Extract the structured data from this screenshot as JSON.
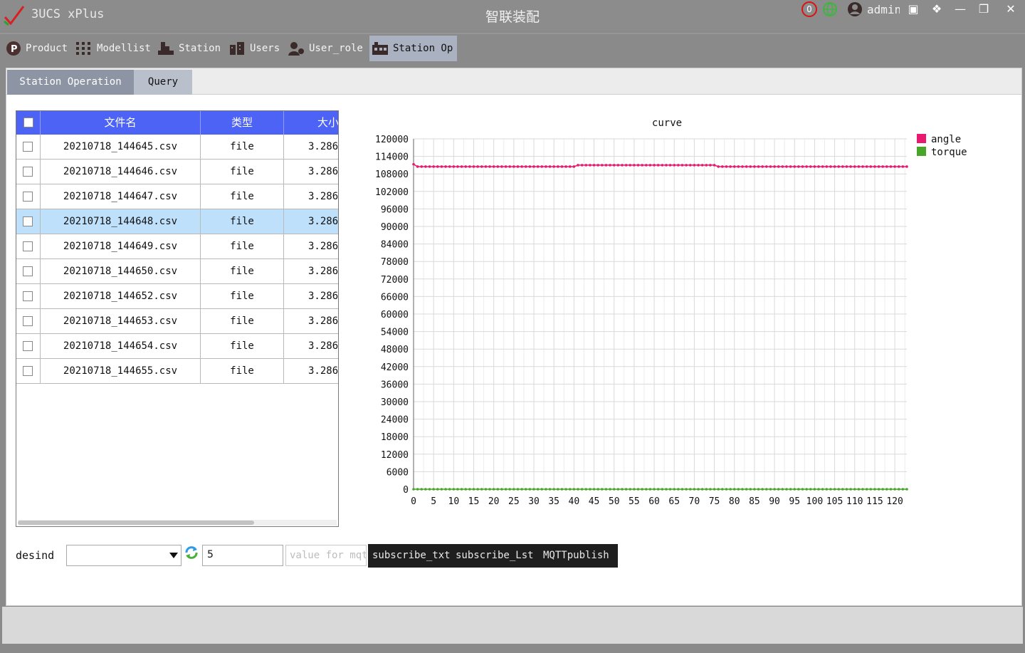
{
  "window": {
    "app_title": "3UCS xPlus",
    "center_title": "智联装配",
    "notification_count": "0",
    "user_name": "admin"
  },
  "nav": [
    {
      "label": "Product",
      "icon": "product-icon"
    },
    {
      "label": "Modellist",
      "icon": "modellist-icon"
    },
    {
      "label": "Station",
      "icon": "station-icon"
    },
    {
      "label": "Users",
      "icon": "users-icon"
    },
    {
      "label": "User_role",
      "icon": "user-role-icon"
    },
    {
      "label": "Station Op",
      "icon": "station-op-icon",
      "active": true
    }
  ],
  "tabs": [
    {
      "label": "Station Operation"
    },
    {
      "label": "Query"
    }
  ],
  "table": {
    "columns": [
      "文件名",
      "类型",
      "大小"
    ],
    "rows": [
      {
        "name": "20210718_144645.csv",
        "type": "file",
        "size": "3.286"
      },
      {
        "name": "20210718_144646.csv",
        "type": "file",
        "size": "3.286"
      },
      {
        "name": "20210718_144647.csv",
        "type": "file",
        "size": "3.286"
      },
      {
        "name": "20210718_144648.csv",
        "type": "file",
        "size": "3.286",
        "selected": true
      },
      {
        "name": "20210718_144649.csv",
        "type": "file",
        "size": "3.286"
      },
      {
        "name": "20210718_144650.csv",
        "type": "file",
        "size": "3.286"
      },
      {
        "name": "20210718_144652.csv",
        "type": "file",
        "size": "3.286"
      },
      {
        "name": "20210718_144653.csv",
        "type": "file",
        "size": "3.286"
      },
      {
        "name": "20210718_144654.csv",
        "type": "file",
        "size": "3.286"
      },
      {
        "name": "20210718_144655.csv",
        "type": "file",
        "size": "3.286"
      }
    ]
  },
  "controls": {
    "desind_label": "desind",
    "combo_value": "",
    "number_value": "5",
    "mqtt_placeholder": "value for mqtt",
    "buttons": [
      "subscribe_txt",
      "subscribe_Lst",
      "MQTTpublish"
    ]
  },
  "chart_data": {
    "type": "line",
    "title": "curve",
    "xlabel": "",
    "ylabel": "",
    "xlim": [
      0,
      123
    ],
    "ylim": [
      0,
      120000
    ],
    "x_ticks": [
      0,
      5,
      10,
      15,
      20,
      25,
      30,
      35,
      40,
      45,
      50,
      55,
      60,
      65,
      70,
      75,
      80,
      85,
      90,
      95,
      100,
      105,
      110,
      115,
      120
    ],
    "y_ticks": [
      0,
      6000,
      12000,
      18000,
      24000,
      30000,
      36000,
      42000,
      48000,
      54000,
      60000,
      66000,
      72000,
      78000,
      84000,
      90000,
      96000,
      102000,
      108000,
      114000,
      120000
    ],
    "grid": true,
    "legend_position": "top-right",
    "series": [
      {
        "name": "angle",
        "color": "#e8196e",
        "segments": [
          {
            "x_from": 0,
            "x_to": 0,
            "y": 111300
          },
          {
            "x_from": 1,
            "x_to": 40,
            "y": 110500
          },
          {
            "x_from": 41,
            "x_to": 75,
            "y": 111000
          },
          {
            "x_from": 76,
            "x_to": 123,
            "y": 110500
          }
        ]
      },
      {
        "name": "torque",
        "color": "#49a52a",
        "segments": [
          {
            "x_from": 0,
            "x_to": 123,
            "y": 0
          }
        ]
      }
    ]
  }
}
